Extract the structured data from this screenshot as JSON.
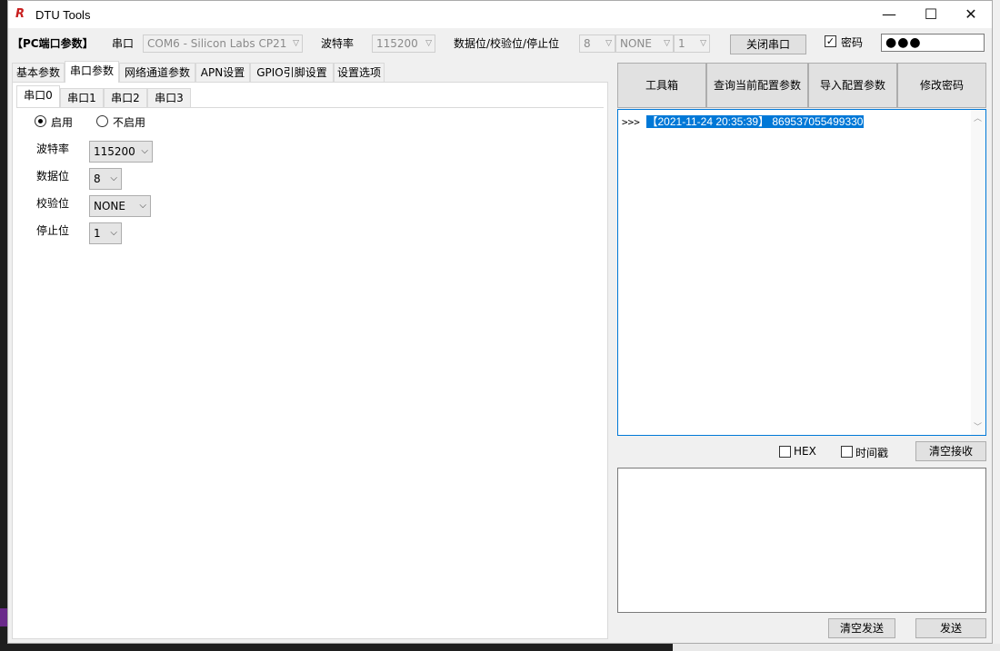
{
  "window": {
    "title": "DTU Tools",
    "logo": "R",
    "controls": {
      "minimize": "—",
      "maximize": "☐",
      "close": "✕"
    }
  },
  "topbar": {
    "section_label": "【PC端口参数】",
    "port_label": "串口",
    "port_value": "COM6 - Silicon Labs CP21",
    "baud_label": "波特率",
    "baud_value": "115200",
    "format_label": "数据位/校验位/停止位",
    "data_bits": "8",
    "parity": "NONE",
    "stop_bits": "1",
    "close_port_button": "关闭串口",
    "password_label": "密码",
    "password_checked": true,
    "password_value": "●●●"
  },
  "tabs": [
    {
      "label": "基本参数",
      "active": false
    },
    {
      "label": "串口参数",
      "active": true
    },
    {
      "label": "网络通道参数",
      "active": false
    },
    {
      "label": "APN设置",
      "active": false
    },
    {
      "label": "GPIO引脚设置",
      "active": false
    },
    {
      "label": "设置选项",
      "active": false
    }
  ],
  "subtabs": [
    {
      "label": "串口0",
      "active": true
    },
    {
      "label": "串口1",
      "active": false
    },
    {
      "label": "串口2",
      "active": false
    },
    {
      "label": "串口3",
      "active": false
    }
  ],
  "serial_settings": {
    "enable_label": "启用",
    "disable_label": "不启用",
    "enabled": true,
    "baud_label": "波特率",
    "baud_value": "115200",
    "databits_label": "数据位",
    "databits_value": "8",
    "parity_label": "校验位",
    "parity_value": "NONE",
    "stopbits_label": "停止位",
    "stopbits_value": "1"
  },
  "actions": {
    "toolbox": "工具箱",
    "query_config": "查询当前配置参数",
    "import_config": "导入配置参数",
    "change_password": "修改密码"
  },
  "receive": {
    "prompt": ">>> ",
    "line": "【2021-11-24 20:35:39】 869537055499330",
    "hex_label": "HEX",
    "timestamp_label": "时间戳",
    "clear_button": "清空接收"
  },
  "send": {
    "clear_button": "清空发送",
    "send_button": "发送"
  },
  "colors": {
    "accent": "#0078d7",
    "logo": "#c81e1e"
  }
}
